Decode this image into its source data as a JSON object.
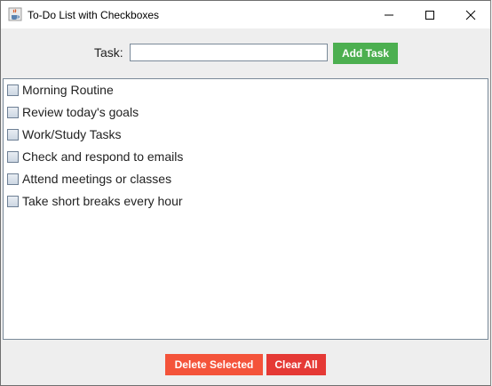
{
  "window": {
    "title": "To-Do List with Checkboxes",
    "icon": "java-cup-icon"
  },
  "form": {
    "task_label": "Task:",
    "task_input_value": "",
    "add_button_label": "Add Task"
  },
  "tasks": [
    {
      "label": "Morning Routine",
      "checked": false
    },
    {
      "label": "Review today's goals",
      "checked": false
    },
    {
      "label": "Work/Study Tasks",
      "checked": false
    },
    {
      "label": "Check and respond to emails",
      "checked": false
    },
    {
      "label": "Attend meetings or classes",
      "checked": false
    },
    {
      "label": "Take short breaks every hour",
      "checked": false
    }
  ],
  "actions": {
    "delete_label": "Delete Selected",
    "clear_label": "Clear All"
  },
  "colors": {
    "add_button": "#4caf50",
    "delete_button": "#f4533a",
    "clear_button": "#e53935"
  }
}
